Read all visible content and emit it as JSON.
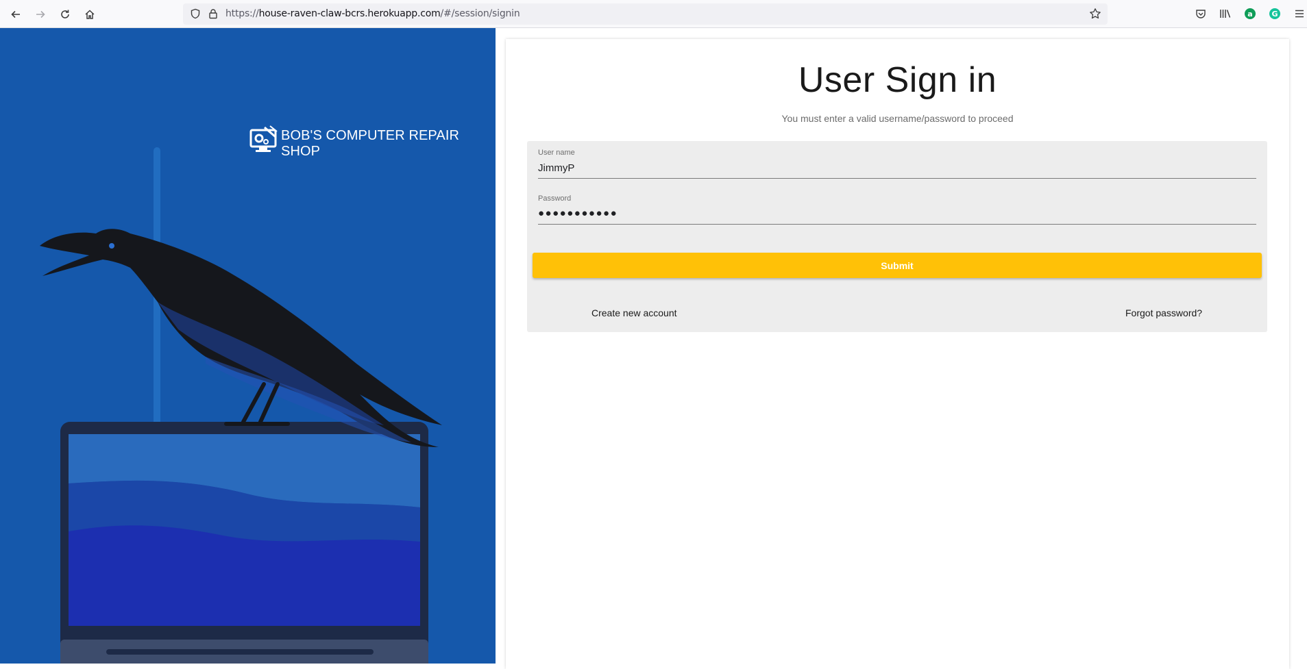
{
  "browser": {
    "url_prefix": "https://",
    "url_host": "house-raven-claw-bcrs.herokuapp.com",
    "url_path": "/#/session/signin",
    "icons": [
      "back-icon",
      "forward-icon",
      "reload-icon",
      "home-icon",
      "shield-icon",
      "lock-icon",
      "bookmark-star-icon",
      "pocket-icon",
      "library-icon",
      "extension-a-icon",
      "extension-g-icon",
      "menu-icon"
    ],
    "ext_a": "a",
    "ext_g": "G",
    "colors": {
      "ext_a": "#0f9d58",
      "ext_g": "#15c39a"
    }
  },
  "hero": {
    "brand_name": "BOB'S COMPUTER REPAIR SHOP",
    "background": "#1558ab"
  },
  "signin": {
    "title": "User Sign in",
    "subtitle": "You must enter a valid username/password to proceed",
    "username_label": "User name",
    "username_value": "JimmyP",
    "password_label": "Password",
    "password_value": "●●●●●●●●●●●",
    "submit_label": "Submit",
    "create_account_label": "Create new account",
    "forgot_password_label": "Forgot password?",
    "accent": "#ffc107"
  }
}
